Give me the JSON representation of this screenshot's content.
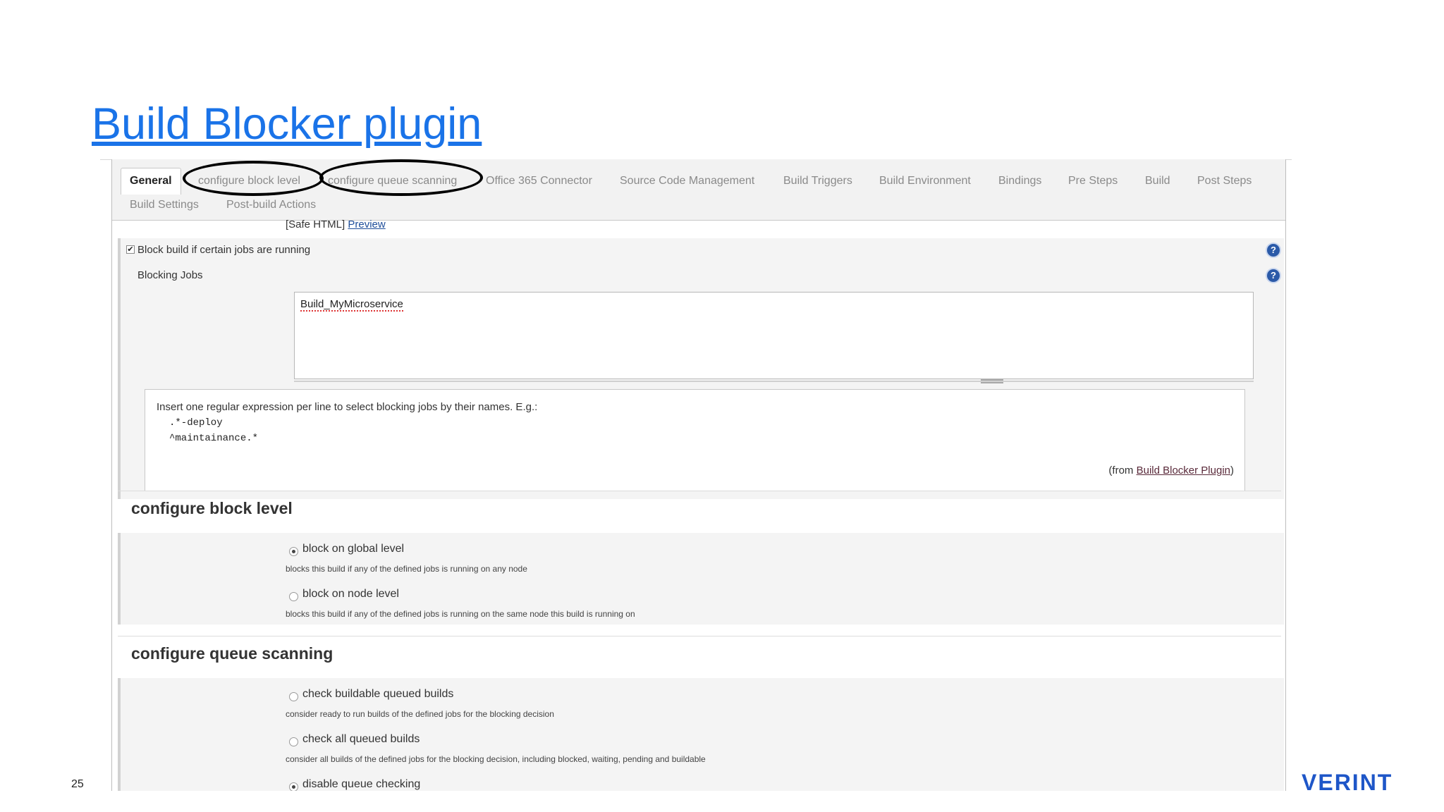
{
  "slide": {
    "title": "Build Blocker plugin",
    "page_number": "25",
    "logo_text": "VERINT"
  },
  "tabs": [
    {
      "label": "General",
      "active": true
    },
    {
      "label": "configure block level",
      "circled": true
    },
    {
      "label": "configure queue scanning",
      "circled": true
    },
    {
      "label": "Office 365 Connector"
    },
    {
      "label": "Source Code Management"
    },
    {
      "label": "Build Triggers"
    },
    {
      "label": "Build Environment"
    },
    {
      "label": "Bindings"
    },
    {
      "label": "Pre Steps"
    },
    {
      "label": "Build"
    },
    {
      "label": "Post Steps"
    },
    {
      "label": "Build Settings"
    },
    {
      "label": "Post-build Actions"
    }
  ],
  "description_footer": {
    "safe_html": "[Safe HTML]",
    "preview_link": "Preview"
  },
  "block_build": {
    "checkbox_label": "Block build if certain jobs are running",
    "checked": true,
    "blocking_jobs_label": "Blocking Jobs",
    "blocking_jobs_value": "Build_MyMicroservice",
    "help_intro": "Insert one regular expression per line to select blocking jobs by their names. E.g.:",
    "help_examples": [
      ".*-deploy",
      "^maintainance.*"
    ],
    "from_prefix": "(from ",
    "from_link": "Build Blocker Plugin",
    "from_suffix": ")"
  },
  "block_level": {
    "heading": "configure block level",
    "options": [
      {
        "label": "block on global level",
        "desc": "blocks this build if any of the defined jobs is running on any node",
        "checked": true
      },
      {
        "label": "block on node level",
        "desc": "blocks this build if any of the defined jobs is running on the same node this build is running on",
        "checked": false
      }
    ]
  },
  "queue_scanning": {
    "heading": "configure queue scanning",
    "options": [
      {
        "label": "check buildable queued builds",
        "desc": "consider ready to run builds of the defined jobs for the blocking decision",
        "checked": false
      },
      {
        "label": "check all queued builds",
        "desc": "consider all builds of the defined jobs for the blocking decision, including blocked, waiting, pending and buildable",
        "checked": false
      },
      {
        "label": "disable queue checking",
        "desc": "",
        "checked": true
      }
    ]
  },
  "icons": {
    "help": "question-mark-help-icon",
    "check": "✔",
    "help_glyph": "?"
  },
  "colors": {
    "title_link": "#1a73e8",
    "logo": "#1e56c8",
    "help_icon": "#2b5aa8",
    "tab_bar": "#f2f2f2"
  }
}
